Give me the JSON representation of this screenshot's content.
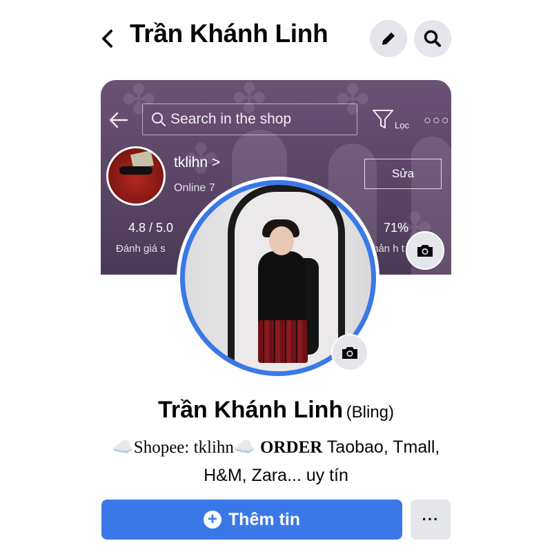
{
  "header": {
    "title": "Trần Khánh Linh",
    "back_icon": "chevron-left-icon",
    "edit_icon": "pencil-icon",
    "search_icon": "search-icon"
  },
  "cover": {
    "search_placeholder": "Search in the shop",
    "filter_label": "Lọc",
    "shop_name": "tklihn >",
    "online": "Online 7",
    "edit_label": "Sửa",
    "rating_value": "4.8 / 5.0",
    "rating_label": "Đánh giá s",
    "response_value": "71%",
    "response_label": "hản h      t",
    "camera_icon": "camera-icon"
  },
  "profile": {
    "name": "Trần Khánh Linh",
    "alternate_name": "(Bling)",
    "bio_shopee": "☁️Shopee: tklihn☁️",
    "bio_order": "ORDER",
    "bio_rest_line1": " Taobao, Tmall,",
    "bio_line2": "H&M, Zara... uy tín",
    "camera_icon": "camera-icon"
  },
  "actions": {
    "add_story_label": "Thêm tin",
    "more_label": "···"
  },
  "colors": {
    "accent": "#3b78e7",
    "button_gray": "#e4e6eb",
    "text": "#050505"
  }
}
